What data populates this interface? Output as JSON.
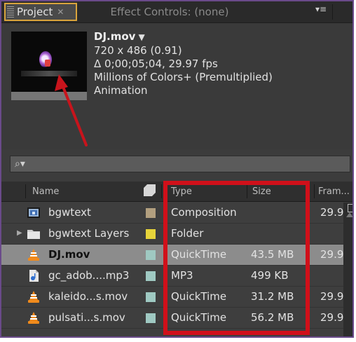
{
  "tabs": {
    "project_label": "Project",
    "effect_label": "Effect Controls: (none)"
  },
  "info": {
    "name": "DJ.mov",
    "dimensions": "720 x 486 (0.91)",
    "duration": "Δ 0;00;05;04, 29.97 fps",
    "colors": "Millions of Colors+ (Premultiplied)",
    "codec": "Animation"
  },
  "search": {
    "icon": "⌕▾",
    "placeholder": ""
  },
  "columns": {
    "name": "Name",
    "type": "Type",
    "size": "Size",
    "frame": "Fram..."
  },
  "rows": [
    {
      "name": "bgwtext",
      "type": "Composition",
      "size": "",
      "frame": "29.9",
      "icon": "composition-icon",
      "label_color": "#b29f7f"
    },
    {
      "name": "bgwtext Layers",
      "type": "Folder",
      "size": "",
      "frame": "",
      "icon": "folder-icon",
      "label_color": "#e7d43a"
    },
    {
      "name": "DJ.mov",
      "type": "QuickTime",
      "size": "43.5 MB",
      "frame": "29.9",
      "icon": "vlc-icon",
      "label_color": "#9fc9c2"
    },
    {
      "name": "gc_adob....mp3",
      "type": "MP3",
      "size": "499 KB",
      "frame": "",
      "icon": "audio-icon",
      "label_color": "#9fc9c2"
    },
    {
      "name": "kaleido...s.mov",
      "type": "QuickTime",
      "size": "31.2 MB",
      "frame": "29.9",
      "icon": "vlc-icon",
      "label_color": "#9fc9c2"
    },
    {
      "name": "pulsati...s.mov",
      "type": "QuickTime",
      "size": "56.2 MB",
      "frame": "29.9",
      "icon": "vlc-icon",
      "label_color": "#9fc9c2"
    }
  ],
  "colors": {
    "panel_bg": "#3c3c3c",
    "tab_active_border": "#d9a43c",
    "highlight": "#d0101a",
    "annotation_arrow": "#d0101a"
  }
}
